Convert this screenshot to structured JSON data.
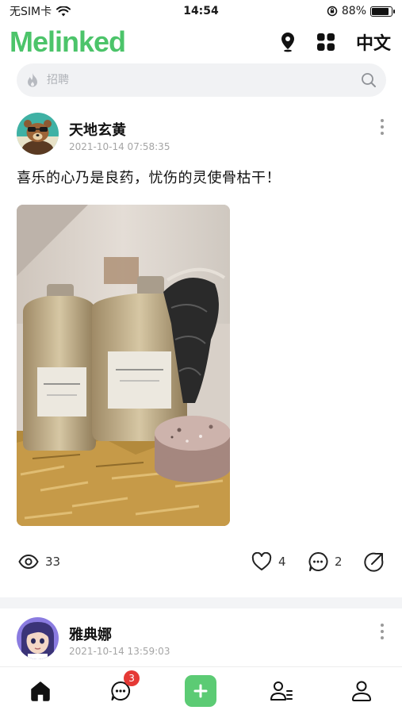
{
  "status_bar": {
    "carrier": "无SIM卡",
    "time": "14:54",
    "battery": "88%",
    "battery_level": 0.88
  },
  "header": {
    "logo": "Melinked",
    "language": "中文"
  },
  "search": {
    "placeholder": "招聘"
  },
  "posts": [
    {
      "author": "天地玄黄",
      "timestamp": "2021-10-14 07:58:35",
      "text": "喜乐的心乃是良药，忧伤的灵使骨枯干！",
      "views": "33",
      "likes": "4",
      "comments": "2"
    },
    {
      "author": "雅典娜",
      "timestamp": "2021-10-14 13:59:03"
    }
  ],
  "nav": {
    "messages_badge": "3"
  },
  "colors": {
    "brand_green": "#4cc46a",
    "add_button": "#5ccb74",
    "badge_red": "#e53935"
  }
}
